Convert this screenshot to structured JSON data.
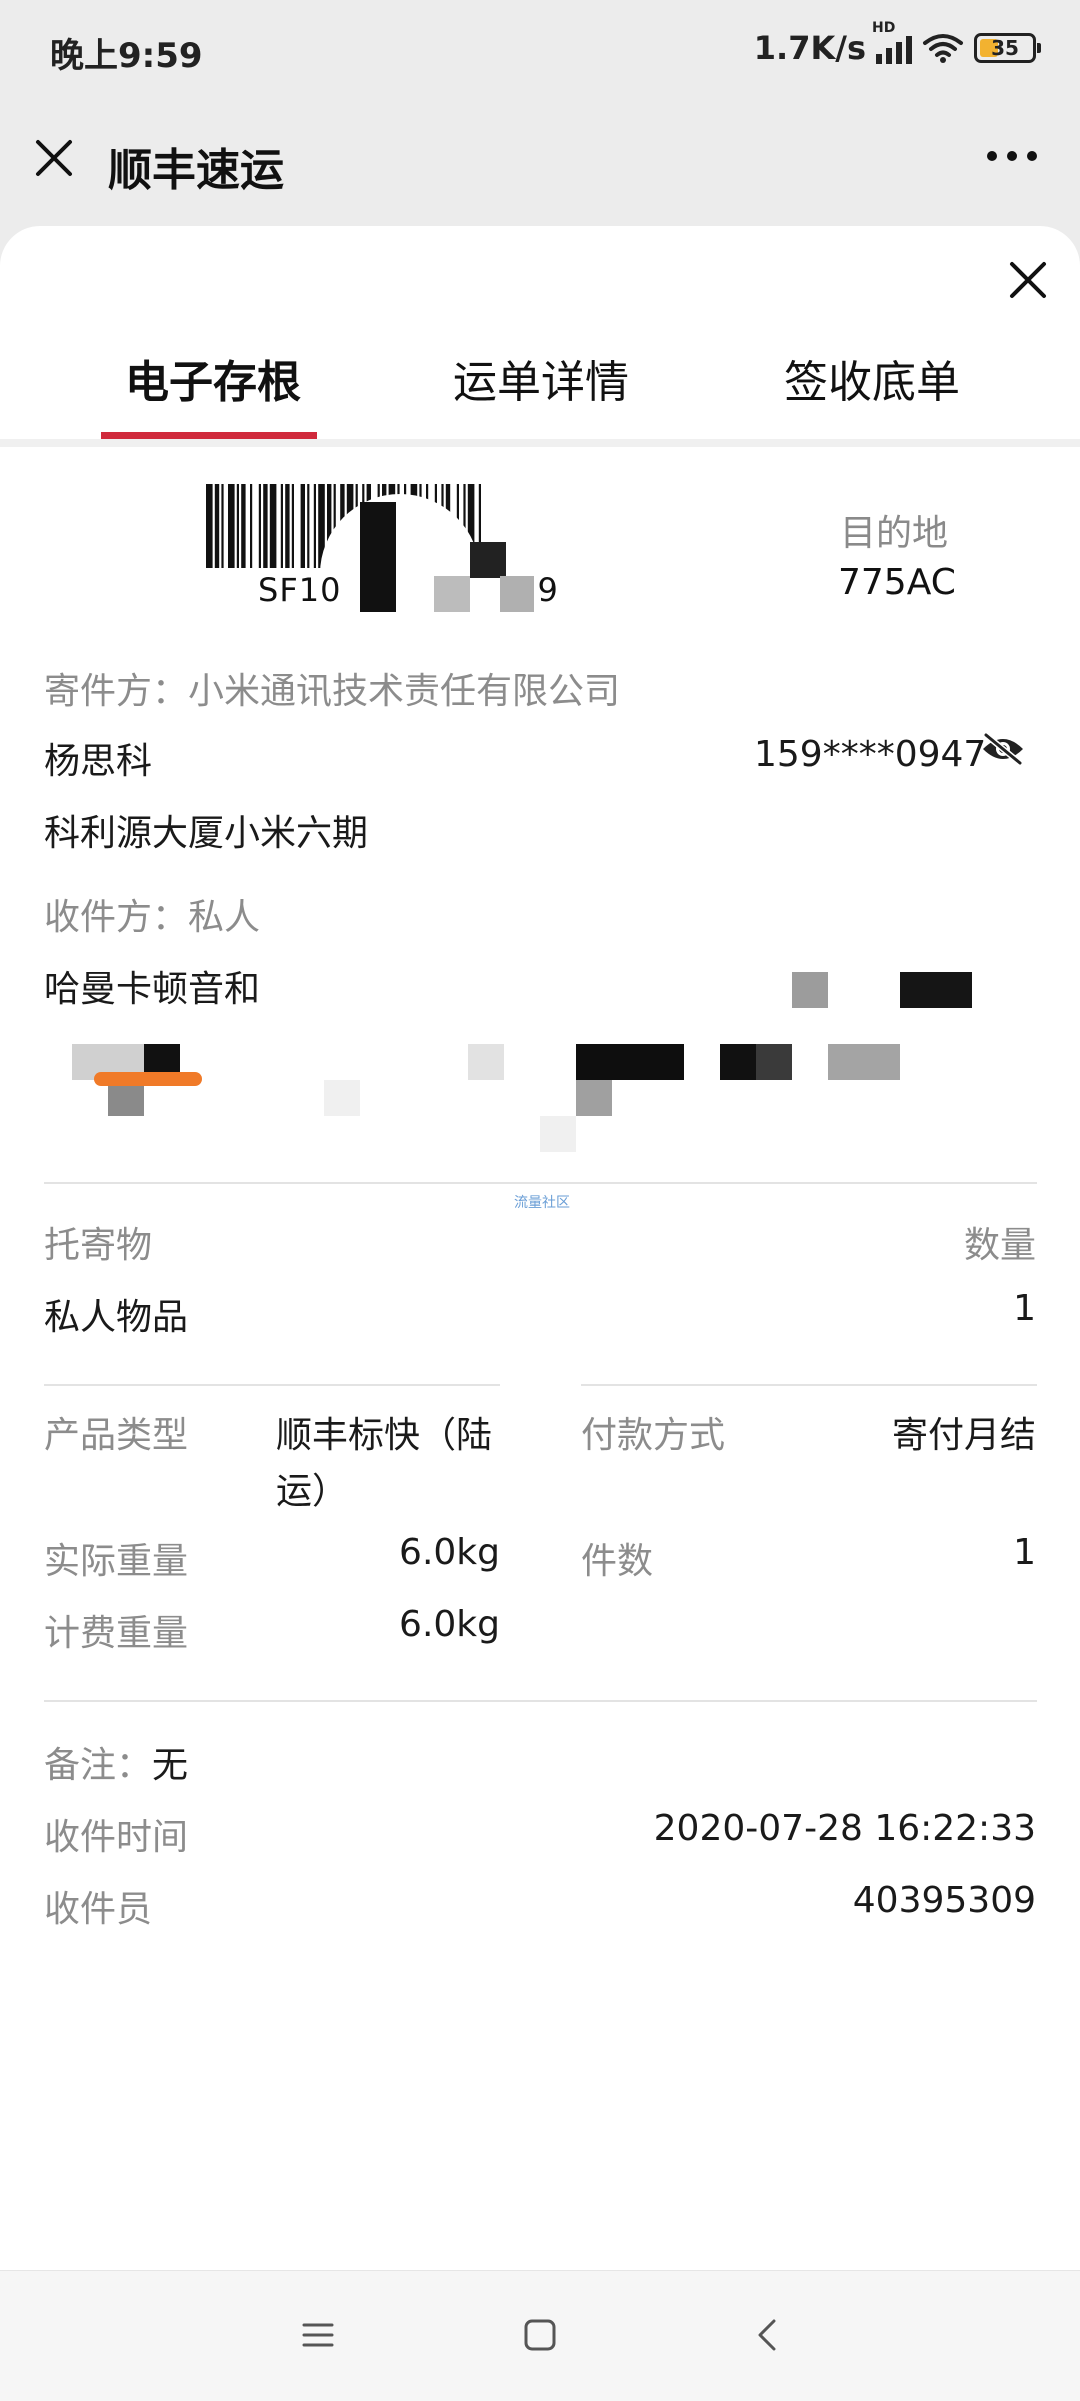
{
  "status_bar": {
    "time": "晚上9:59",
    "speed": "1.7K/s",
    "network": "HD",
    "battery": "35"
  },
  "titlebar": {
    "title": "顺丰速运"
  },
  "tabs": [
    "电子存根",
    "运单详情",
    "签收底单"
  ],
  "waybill": {
    "number_visible": "SF10",
    "number_end": "9",
    "destination_label": "目的地",
    "destination_code": "775AC"
  },
  "sender": {
    "label": "寄件方：小米通讯技术责任有限公司",
    "name": "杨思科",
    "phone": "159****0947",
    "address": "科利源大厦小米六期"
  },
  "receiver": {
    "label": "收件方：私人",
    "address": "哈曼卡顿音和"
  },
  "watermark": "流量社区",
  "goods": {
    "label": "托寄物",
    "qty_label": "数量",
    "value": "私人物品",
    "qty": "1"
  },
  "details": {
    "product_type_label": "产品类型",
    "product_type_line1": "顺丰标快（陆",
    "product_type_line2": "运）",
    "payment_label": "付款方式",
    "payment_value": "寄付月结",
    "actual_weight_label": "实际重量",
    "actual_weight_value": "6.0kg",
    "pieces_label": "件数",
    "pieces_value": "1",
    "billing_weight_label": "计费重量",
    "billing_weight_value": "6.0kg"
  },
  "remarks": {
    "remark_label": "备注：",
    "remark_value": "无",
    "pickup_time_label": "收件时间",
    "pickup_time_value": "2020-07-28 16:22:33",
    "courier_label": "收件员",
    "courier_value": "40395309"
  },
  "colors": {
    "accent": "#d0293b",
    "label_gray": "#8c8c8c",
    "text": "#1a1a1a"
  }
}
